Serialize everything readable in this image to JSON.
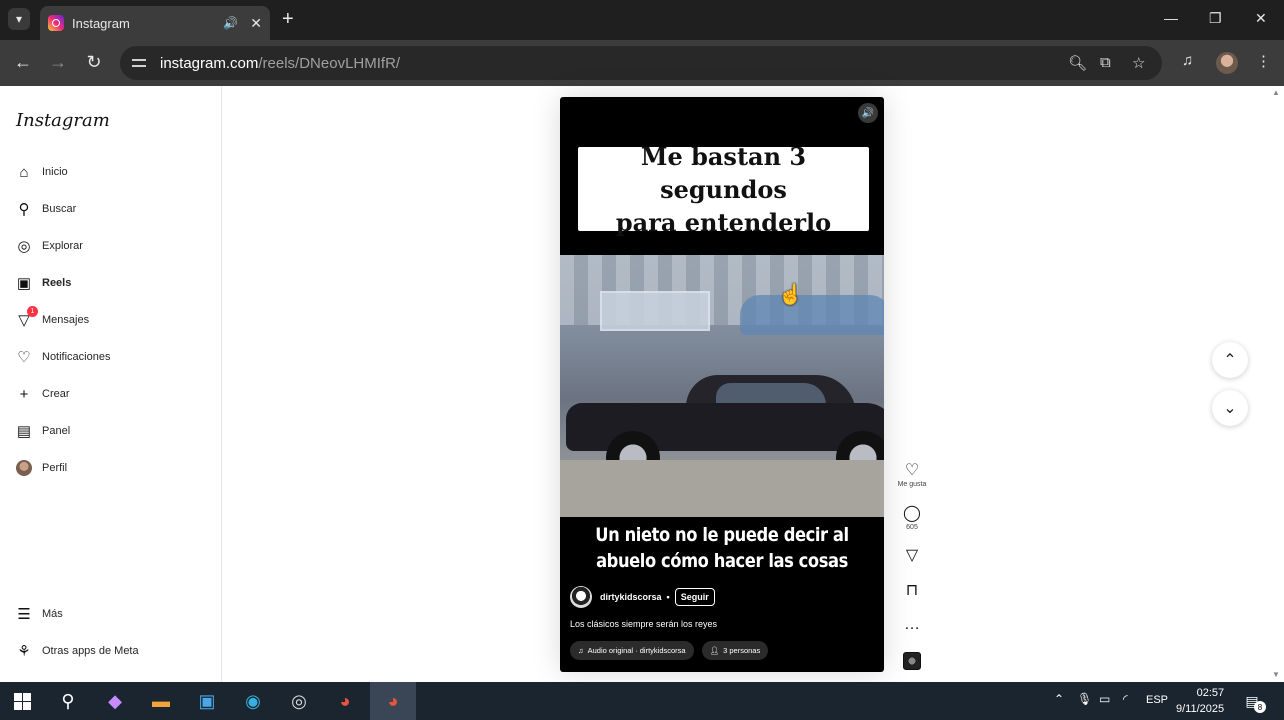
{
  "browser": {
    "tab_title": "Instagram",
    "url_host": "instagram.com",
    "url_path": "/reels/DNeovLHMIfR/"
  },
  "sidebar": {
    "logo": "Instagram",
    "items": [
      {
        "label": "Inicio",
        "icon": "home-icon"
      },
      {
        "label": "Buscar",
        "icon": "search-icon"
      },
      {
        "label": "Explorar",
        "icon": "compass-icon"
      },
      {
        "label": "Reels",
        "icon": "reels-icon"
      },
      {
        "label": "Mensajes",
        "icon": "messages-icon",
        "badge": "1"
      },
      {
        "label": "Notificaciones",
        "icon": "heart-icon"
      },
      {
        "label": "Crear",
        "icon": "plus-icon"
      },
      {
        "label": "Panel",
        "icon": "dashboard-icon"
      },
      {
        "label": "Perfil",
        "icon": "avatar"
      }
    ],
    "more": "Más",
    "meta_apps": "Otras apps de Meta"
  },
  "reel": {
    "top_text": "Me bastan 3 segundos\npara entenderlo",
    "bottom_text": "Un nieto no le puede decir al\nabuelo cómo hacer las cosas",
    "username": "dirtykidscorsa",
    "separator": "•",
    "follow_label": "Seguir",
    "description": "Los clásicos siempre serán los reyes",
    "audio_label": "Audio original · dirtykidscorsa",
    "people_label": "3 personas"
  },
  "actions": {
    "like_label": "Me gusta",
    "comments_count": "605"
  },
  "taskbar": {
    "language": "ESP",
    "time": "02:57",
    "date": "9/11/2025",
    "notifications": "8"
  },
  "colors": {
    "browser_dark": "#1f1f1f",
    "toolbar": "#3c3c3c",
    "taskbar": "#1b2530",
    "badge_red": "#ff3040"
  }
}
